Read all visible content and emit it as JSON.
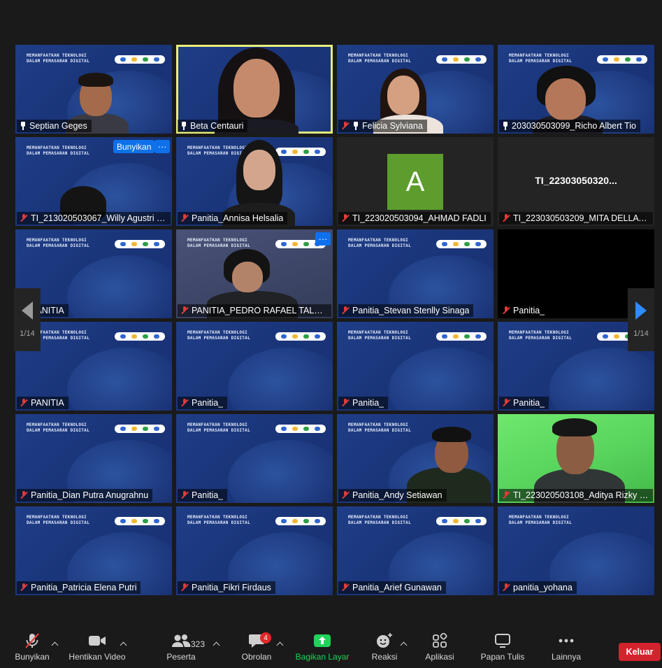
{
  "meeting": {
    "banner_title": "MEMANFAATKAN TEKNOLOGI DALAM PEMASARAN DIGITAL",
    "accent_color": "#2d8cff",
    "active_speaker_color": "#e8ef7a",
    "muted_color": "#e23b3b"
  },
  "tiles": [
    {
      "name": "Septian Geges",
      "icon": "pin-icon"
    },
    {
      "name": "Beta Centauri",
      "icon": "pin-icon"
    },
    {
      "name": "Felicia Sylviana",
      "icon": "pin-icon"
    },
    {
      "name": "203030503099_Richo Albert Tio",
      "icon": "pin-icon"
    },
    {
      "name": "TI_213020503067_Willy Agustri D...",
      "icon": "muted-mic-icon"
    },
    {
      "name": "Panitia_Annisa Helsalia",
      "icon": "muted-mic-icon"
    },
    {
      "name": "TI_223020503094_AHMAD FADLI",
      "icon": "muted-mic-icon",
      "avatar_letter": "A"
    },
    {
      "name": "TI_223030503209_MITA DELLA P...",
      "icon": "muted-mic-icon",
      "center_name": "TI_22303050320..."
    },
    {
      "name": "PANITIA",
      "icon": "muted-mic-icon"
    },
    {
      "name": "PANITIA_PEDRO RAFAEL TALENTA",
      "icon": "muted-mic-icon"
    },
    {
      "name": "Panitia_Stevan Stenlly Sinaga",
      "icon": "muted-mic-icon"
    },
    {
      "name": "Panitia_",
      "icon": "muted-mic-icon"
    },
    {
      "name": "PANITIA",
      "icon": "muted-mic-icon"
    },
    {
      "name": "Panitia_",
      "icon": "muted-mic-icon"
    },
    {
      "name": "Panitia_",
      "icon": "muted-mic-icon"
    },
    {
      "name": "Panitia_",
      "icon": "muted-mic-icon"
    },
    {
      "name": "Panitia_Dian Putra Anugrahnu",
      "icon": "muted-mic-icon"
    },
    {
      "name": "Panitia_",
      "icon": "muted-mic-icon"
    },
    {
      "name": "Panitia_Andy Setiawan",
      "icon": "muted-mic-icon"
    },
    {
      "name": "TI_223020503108_Aditya Rizky Fe...",
      "icon": "muted-mic-icon"
    },
    {
      "name": "Panitia_Patricia Elena Putri",
      "icon": "muted-mic-icon"
    },
    {
      "name": "Panitia_Fikri Firdaus",
      "icon": "muted-mic-icon"
    },
    {
      "name": "Panitia_Arief Gunawan",
      "icon": "muted-mic-icon"
    },
    {
      "name": "panitia_yohana",
      "icon": "muted-mic-icon"
    }
  ],
  "hover_actions": {
    "unmute_label": "Bunyikan",
    "more_label": "···"
  },
  "pager": {
    "left_page": "1/14",
    "right_page": "1/14"
  },
  "toolbar": {
    "unmute_label": "Bunyikan",
    "stop_video_label": "Hentikan Video",
    "participants_label": "Peserta",
    "participants_count": "323",
    "chat_label": "Obrolan",
    "chat_badge": "4",
    "share_label": "Bagikan Layar",
    "reactions_label": "Reaksi",
    "apps_label": "Aplikasi",
    "whiteboard_label": "Papan Tulis",
    "more_label": "Lainnya",
    "leave_label": "Keluar"
  }
}
